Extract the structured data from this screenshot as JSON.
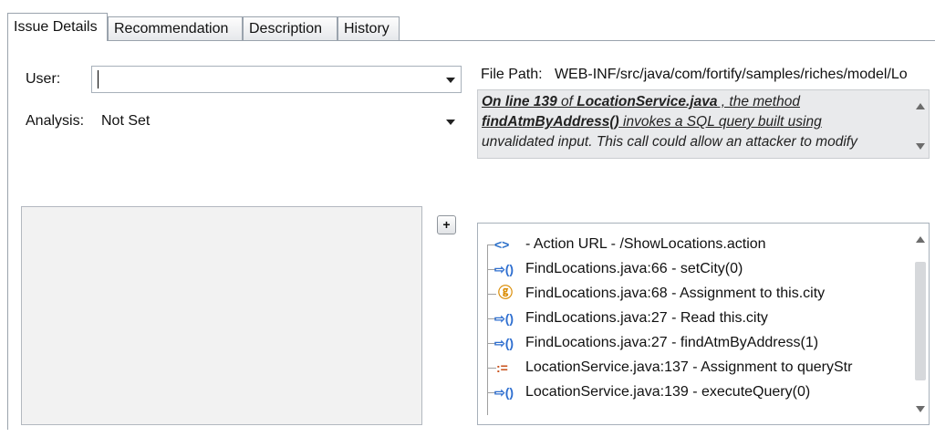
{
  "tabs": [
    {
      "label": "Issue Details",
      "active": true
    },
    {
      "label": "Recommendation",
      "active": false
    },
    {
      "label": "Description",
      "active": false
    },
    {
      "label": "History",
      "active": false
    }
  ],
  "form": {
    "user_label": "User:",
    "user_value": "",
    "analysis_label": "Analysis:",
    "analysis_value": "Not Set"
  },
  "file_path": {
    "label": "File Path:",
    "value": "WEB-INF/src/java/com/fortify/samples/riches/model/Lo"
  },
  "abstract": {
    "line1_a": "On line 139",
    "line1_b": " of ",
    "line1_c": "LocationService.java",
    "line1_d": " , the method",
    "line2_a": "findAtmByAddress()",
    "line2_b": "  invokes a SQL query built using",
    "line3": "unvalidated input. This call could allow an attacker to modify"
  },
  "add_button": "+",
  "trace": [
    {
      "icon": "<>",
      "text": "- Action URL - /ShowLocations.action",
      "icon_name": "endpoint-icon",
      "color": "#2a6fc9"
    },
    {
      "icon": "⇨()",
      "text": "FindLocations.java:66 - setCity(0)",
      "icon_name": "call-arrow-icon",
      "color": "#2f6fd0"
    },
    {
      "icon": "ⓖ",
      "text": "FindLocations.java:68 - Assignment to this.city",
      "icon_name": "global-assign-icon",
      "color": "#d98a00"
    },
    {
      "icon": "⇨()",
      "text": "FindLocations.java:27 - Read this.city",
      "icon_name": "call-arrow-icon",
      "color": "#2f6fd0"
    },
    {
      "icon": "⇨()",
      "text": "FindLocations.java:27 - findAtmByAddress(1)",
      "icon_name": "call-arrow-icon",
      "color": "#2f6fd0"
    },
    {
      "icon": ":=",
      "text": "LocationService.java:137 - Assignment to queryStr",
      "icon_name": "assignment-icon",
      "color": "#c8501a"
    },
    {
      "icon": "⇨()",
      "text": "LocationService.java:139 - executeQuery(0)",
      "icon_name": "call-arrow-icon",
      "color": "#2f6fd0"
    }
  ]
}
